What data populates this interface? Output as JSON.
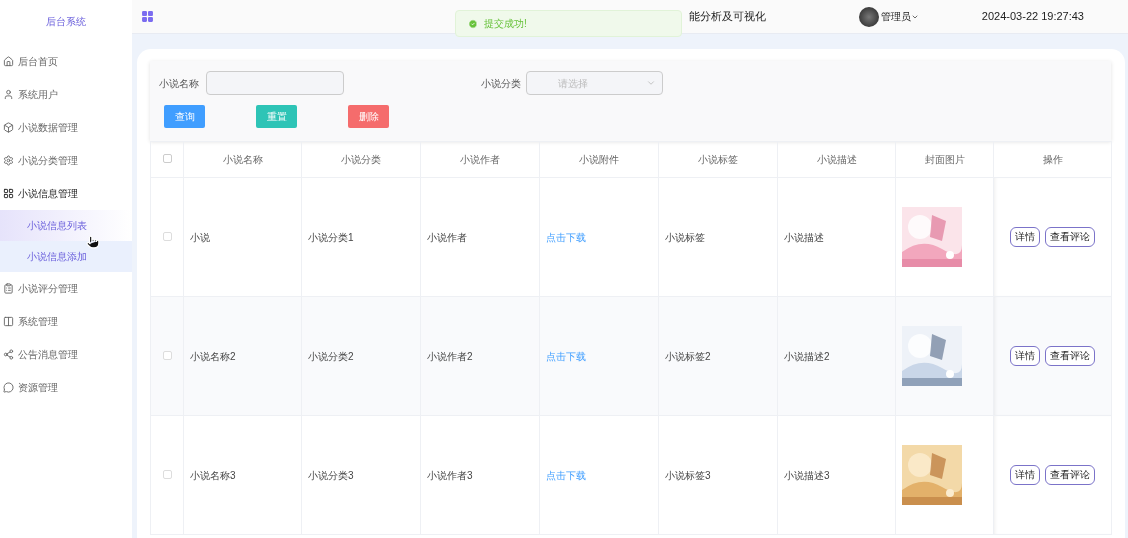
{
  "sidebar": {
    "title": "后台系统",
    "items": [
      {
        "label": "后台首页",
        "expanded": false
      },
      {
        "label": "系统用户",
        "expanded": false
      },
      {
        "label": "小说数据管理",
        "expanded": false
      },
      {
        "label": "小说分类管理",
        "expanded": false
      },
      {
        "label": "小说信息管理",
        "expanded": true,
        "children": [
          {
            "label": "小说信息列表",
            "selected": true,
            "hover": false
          },
          {
            "label": "小说信息添加",
            "selected": false,
            "hover": true
          }
        ]
      },
      {
        "label": "小说评分管理",
        "expanded": false
      },
      {
        "label": "系统管理",
        "expanded": false
      },
      {
        "label": "公告消息管理",
        "expanded": false
      },
      {
        "label": "资源管理",
        "expanded": false
      }
    ]
  },
  "header": {
    "title": "能分析及可视化",
    "user": "管理员",
    "datetime": "2024-03-22 19:27:43"
  },
  "toast": {
    "message": "提交成功!"
  },
  "filters": {
    "name_label": "小说名称",
    "category_label": "小说分类",
    "category_placeholder": "请选择"
  },
  "buttons": [
    {
      "label": "查询",
      "kind": "primary"
    },
    {
      "label": "重置",
      "kind": "success"
    },
    {
      "label": "删除",
      "kind": "danger"
    }
  ],
  "table": {
    "select_all_checked": false,
    "columns": [
      "小说名称",
      "小说分类",
      "小说作者",
      "小说附件",
      "小说标签",
      "小说描述",
      "封面图片",
      "操作"
    ],
    "rows": [
      {
        "checked": false,
        "name": "小说",
        "category": "小说分类1",
        "author": "小说作者",
        "attachment": "点击下载",
        "tags": "小说标签",
        "description": "小说描述",
        "cover": {
          "kind": "picture"
        },
        "actions": [
          "详情",
          "查看评论"
        ]
      },
      {
        "checked": false,
        "name": "小说名称2",
        "category": "小说分类2",
        "author": "小说作者2",
        "attachment": "点击下载",
        "tags": "小说标签2",
        "description": "小说描述2",
        "cover": {
          "kind": "picture"
        },
        "actions": [
          "详情",
          "查看评论"
        ]
      },
      {
        "checked": false,
        "name": "小说名称3",
        "category": "小说分类3",
        "author": "小说作者3",
        "attachment": "点击下载",
        "tags": "小说标签3",
        "description": "小说描述3",
        "cover": {
          "kind": "picture"
        },
        "actions": [
          "详情",
          "查看评论"
        ]
      }
    ]
  }
}
